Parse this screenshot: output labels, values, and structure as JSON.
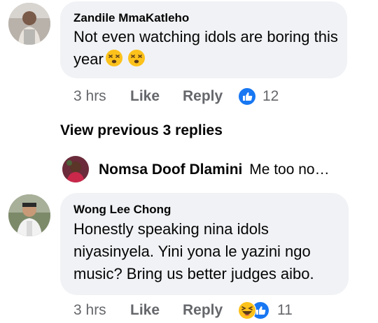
{
  "comments": [
    {
      "author": "Zandile MmaKatleho",
      "text": "Not even watching idols are boring this year",
      "time": "3 hrs",
      "like_label": "Like",
      "reply_label": "Reply",
      "reaction_count": "12",
      "reaction_icons": [
        "like-icon"
      ],
      "emojis": [
        "dizzy-face-icon",
        "dizzy-face-icon"
      ]
    },
    {
      "author": "Wong Lee Chong",
      "text": "Honestly speaking nina idols niyasinyela. Yini yona le yazini ngo music? Bring us better judges aibo.",
      "time": "3 hrs",
      "like_label": "Like",
      "reply_label": "Reply",
      "reaction_count": "11",
      "reaction_icons": [
        "haha-icon",
        "like-icon"
      ]
    }
  ],
  "view_previous_replies": "View previous 3 replies",
  "reply_preview": {
    "author": "Nomsa Doof Dlamini",
    "snippet": "Me too no…"
  },
  "colors": {
    "bubble": "#f0f2f5",
    "meta": "#65676b",
    "like_blue": "#1877f2"
  }
}
